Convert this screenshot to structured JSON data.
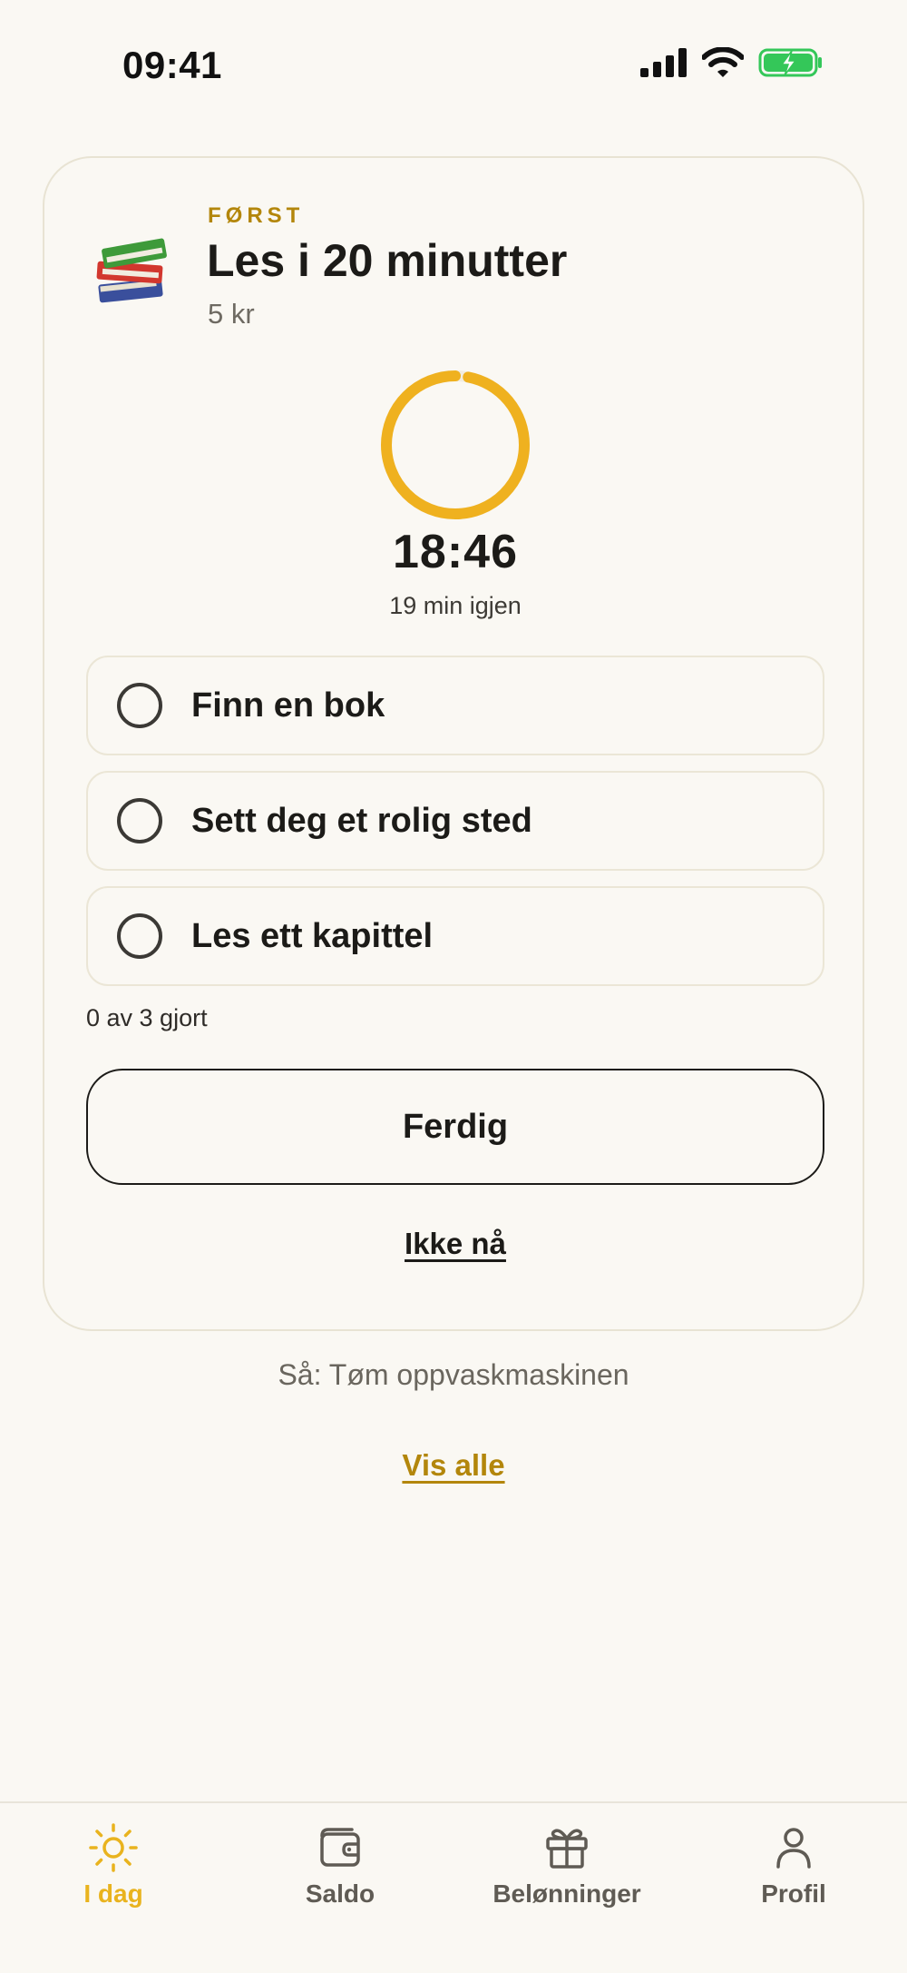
{
  "status_bar": {
    "time": "09:41",
    "icons": [
      "cellular-signal-icon",
      "wifi-icon",
      "battery-charging-icon"
    ]
  },
  "current_task": {
    "kicker": "FØRST",
    "title": "Les i 20 minutter",
    "reward": "5 kr",
    "icon": "books-emoji",
    "timer": {
      "time": "18:46",
      "remaining": "19 min igjen",
      "progress": 0.97
    },
    "steps": [
      {
        "label": "Finn en bok",
        "done": false
      },
      {
        "label": "Sett deg et rolig sted",
        "done": false
      },
      {
        "label": "Les ett kapittel",
        "done": false
      }
    ],
    "progress_text": "0 av 3 gjort",
    "done_button": "Ferdig",
    "skip_link": "Ikke nå"
  },
  "next_task": "Så: Tøm oppvaskmaskinen",
  "show_all": "Vis alle",
  "tab_bar": {
    "tabs": [
      {
        "label": "I dag",
        "icon": "sun-icon",
        "active": true
      },
      {
        "label": "Saldo",
        "icon": "wallet-icon",
        "active": false
      },
      {
        "label": "Belønninger",
        "icon": "gift-icon",
        "active": false
      },
      {
        "label": "Profil",
        "icon": "person-icon",
        "active": false
      }
    ]
  },
  "colors": {
    "background": "#faf8f3",
    "accent": "#e9b31e",
    "accent_text": "#b3860b",
    "battery_green": "#34c759"
  }
}
